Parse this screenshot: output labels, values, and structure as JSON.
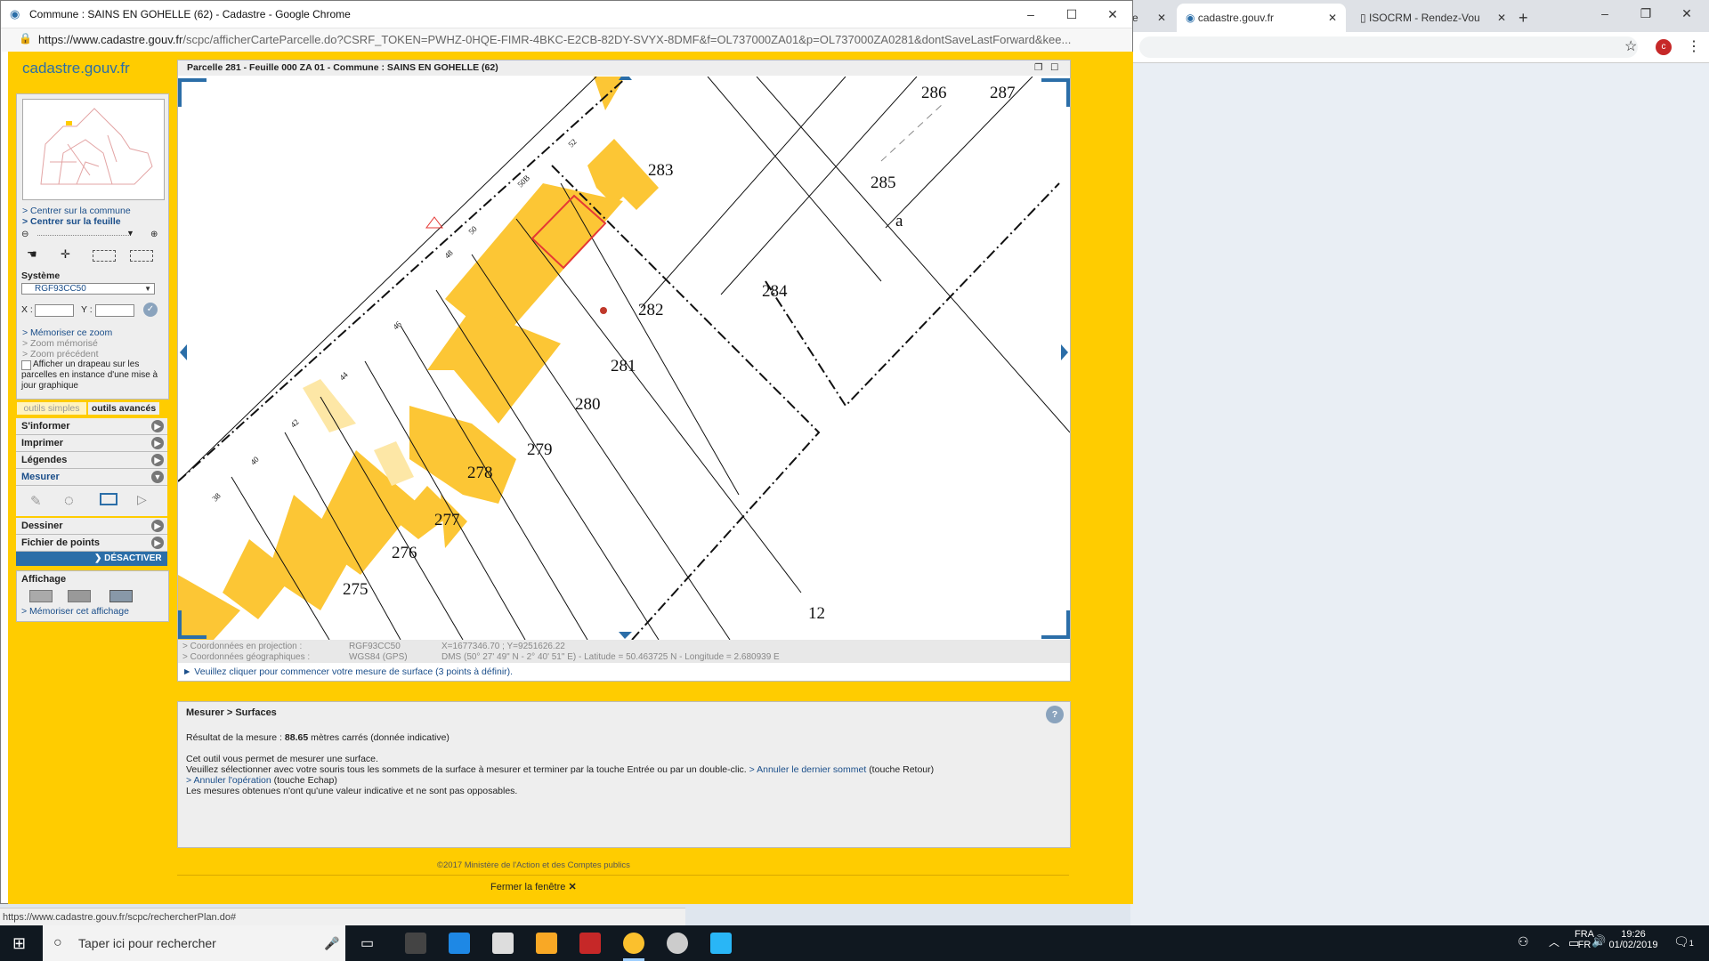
{
  "popup": {
    "title": "Commune : SAINS EN GOHELLE (62) - Cadastre - Google Chrome",
    "url_host": "https://www.cadastre.gouv.fr",
    "url_path": "/scpc/afficherCarteParcelle.do?CSRF_TOKEN=PWHZ-0HQE-FIMR-4BKC-E2CB-82DY-SVYX-8DMF&f=OL737000ZA01&p=OL737000ZA0281&dontSaveLastForward&kee...",
    "logo": "cadastre.gouv.fr"
  },
  "background_tabs": [
    {
      "label": "e"
    },
    {
      "label": "cadastre.gouv.fr"
    },
    {
      "label": "ISOCRM - Rendez-Vou"
    }
  ],
  "left_panel": {
    "center_commune": "> Centrer sur la commune",
    "center_feuille": "> Centrer sur la feuille",
    "system_label": "Système",
    "system_value": "RGF93CC50",
    "x_label": "X :",
    "y_label": "Y :",
    "memorize_zoom": "> Mémoriser ce zoom",
    "zoom_memorized": "> Zoom mémorisé",
    "zoom_previous": "> Zoom précédent",
    "flag_checkbox": "Afficher un drapeau sur les parcelles en instance d'une mise à jour graphique",
    "tab_simple": "outils simples",
    "tab_advanced": "outils avancés"
  },
  "menu": {
    "informer": "S'informer",
    "imprimer": "Imprimer",
    "legendes": "Légendes",
    "mesurer": "Mesurer",
    "dessiner": "Dessiner",
    "fichier": "Fichier de points",
    "desactiver": "DÉSACTIVER",
    "affichage": "Affichage",
    "memorize_display": "> Mémoriser cet affichage"
  },
  "map": {
    "header": "Parcelle 281 - Feuille 000 ZA 01 - Commune : SAINS EN GOHELLE (62)",
    "parcels": [
      "286",
      "287",
      "283",
      "285",
      "a",
      "284",
      "282",
      "281",
      "280",
      "279",
      "278",
      "277",
      "276",
      "275",
      "12"
    ],
    "street_numbers": [
      "52",
      "50B",
      "50",
      "48",
      "46",
      "44",
      "42",
      "40",
      "38"
    ]
  },
  "coords": {
    "proj_label": "> Coordonnées en projection :",
    "proj_system": "RGF93CC50",
    "proj_value": "X=1677346.70 ; Y=9251626.22",
    "geo_label": "> Coordonnées géographiques :",
    "geo_system": "WGS84 (GPS)",
    "geo_value": "DMS (50° 27' 49\" N - 2° 40' 51\" E) - Latitude = 50.463725 N - Longitude = 2.680939 E"
  },
  "hint": "► Veuillez cliquer pour commencer votre mesure de surface (3 points à définir).",
  "result": {
    "title": "Mesurer > Surfaces",
    "result_label": "Résultat de la mesure :",
    "result_value": "88.65",
    "result_unit": "mètres carrés (donnée indicative)",
    "line1": "Cet outil vous permet de mesurer une surface.",
    "line2": "Veuillez sélectionner avec votre souris tous les sommets de la surface à mesurer et terminer par la touche Entrée ou par un double-clic.",
    "link_undo_vertex": "> Annuler le dernier sommet",
    "undo_vertex_key": "(touche Retour)",
    "link_cancel": "> Annuler l'opération",
    "cancel_key": "(touche Echap)",
    "line4": "Les mesures obtenues n'ont qu'une valeur indicative et ne sont pas opposables."
  },
  "footer": {
    "copyright": "©2017 Ministère de l'Action et des Comptes publics",
    "close": "Fermer la fenêtre"
  },
  "status_url": "https://www.cadastre.gouv.fr/scpc/rechercherPlan.do#",
  "taskbar": {
    "search_placeholder": "Taper ici pour rechercher",
    "lang1": "FRA",
    "lang2": "FR",
    "time": "19:26",
    "date": "01/02/2019",
    "notif_count": "1"
  },
  "colors": {
    "accent": "#ffcc00",
    "building": "#fcc635",
    "selected": "#e53935",
    "link": "#1a4e8a"
  }
}
